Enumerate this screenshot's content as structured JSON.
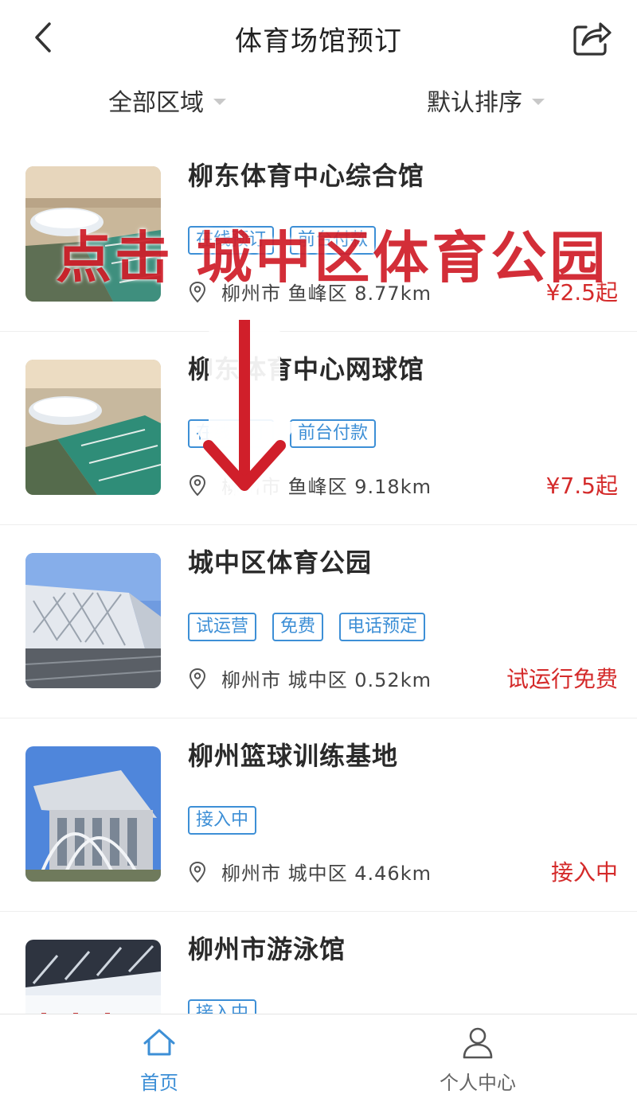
{
  "header": {
    "title": "体育场馆预订",
    "back_icon": "chevron-left-icon",
    "share_icon": "share-icon"
  },
  "filters": {
    "area": "全部区域",
    "sort": "默认排序"
  },
  "venues": [
    {
      "name": "柳东体育中心综合馆",
      "tags": [
        "在线预订",
        "前台付款"
      ],
      "location": "柳州市 鱼峰区 8.77km",
      "price": "¥2.5起"
    },
    {
      "name": "柳东体育中心网球馆",
      "tags": [
        "在线预订",
        "前台付款"
      ],
      "location": "柳州市 鱼峰区 9.18km",
      "price": "¥7.5起"
    },
    {
      "name": "城中区体育公园",
      "tags": [
        "试运营",
        "免费",
        "电话预定"
      ],
      "location": "柳州市 城中区 0.52km",
      "price": "试运行免费"
    },
    {
      "name": "柳州篮球训练基地",
      "tags": [
        "接入中"
      ],
      "location": "柳州市 城中区 4.46km",
      "price": "接入中"
    },
    {
      "name": "柳州市游泳馆",
      "tags": [
        "接入中"
      ],
      "location": "",
      "price": ""
    }
  ],
  "overlay": {
    "instruction": "点击 城中区体育公园"
  },
  "tabbar": {
    "home": "首页",
    "profile": "个人中心"
  },
  "colors": {
    "accent_blue": "#3d8fd6",
    "price_red": "#d42a2a",
    "overlay_red": "#d01f2a"
  }
}
